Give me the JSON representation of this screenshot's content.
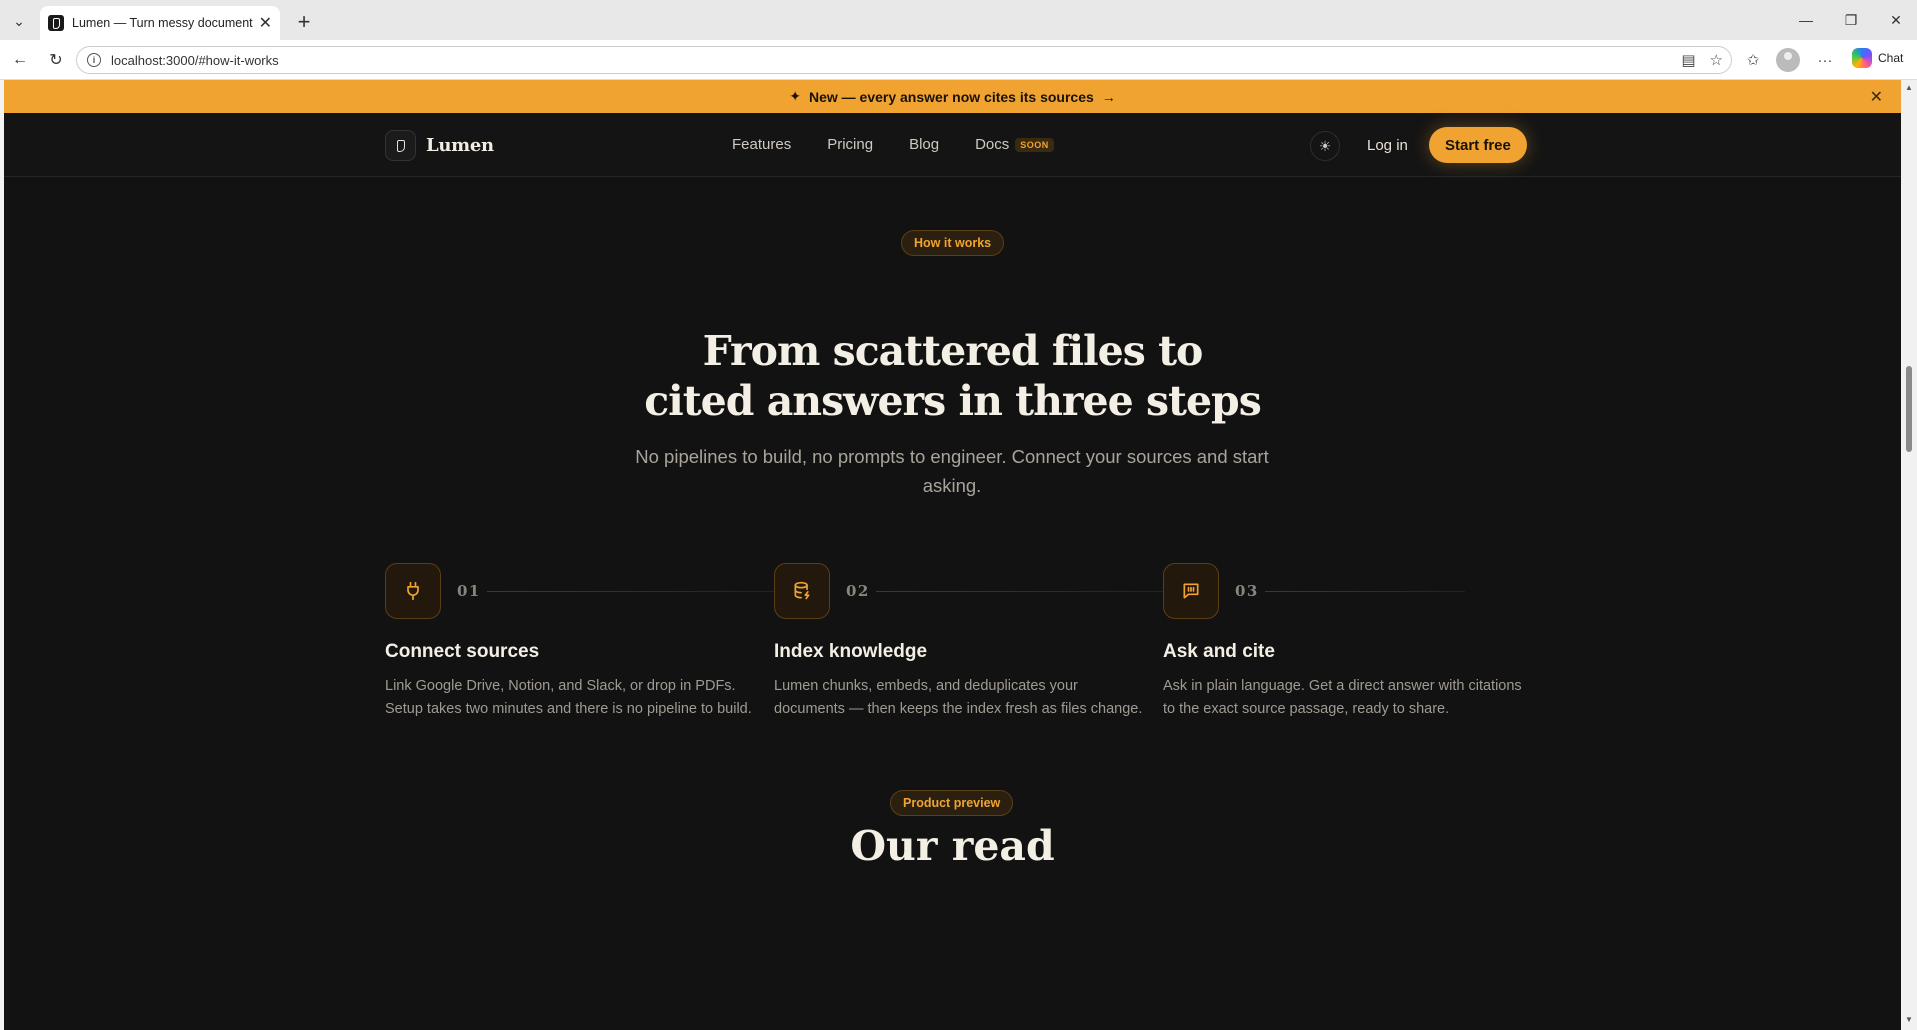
{
  "browser": {
    "tab_title": "Lumen — Turn messy documents",
    "url": "localhost:3000/#how-it-works",
    "chat_label": "Chat"
  },
  "announcement": {
    "text": "New — every answer now cites its sources",
    "arrow": "→"
  },
  "nav": {
    "brand": "Lumen",
    "links": [
      "Features",
      "Pricing",
      "Blog",
      "Docs"
    ],
    "docs_badge": "SOON",
    "login": "Log in",
    "cta": "Start free"
  },
  "how_it_works": {
    "pill": "How it works",
    "headline_line1": "From scattered files to",
    "headline_line2": "cited answers in three steps",
    "subhead": "No pipelines to build, no prompts to engineer. Connect your sources and start asking.",
    "steps": [
      {
        "num": "01",
        "icon": "plug-icon",
        "title": "Connect sources",
        "desc": "Link Google Drive, Notion, and Slack, or drop in PDFs. Setup takes two minutes and there is no pipeline to build."
      },
      {
        "num": "02",
        "icon": "database-icon",
        "title": "Index knowledge",
        "desc": "Lumen chunks, embeds, and deduplicates your documents — then keeps the index fresh as files change."
      },
      {
        "num": "03",
        "icon": "chat-icon",
        "title": "Ask and cite",
        "desc": "Ask in plain language. Get a direct answer with citations to the exact source passage, ready to share."
      }
    ]
  },
  "product_preview": {
    "pill": "Product preview",
    "title_partial": "Our read"
  },
  "colors": {
    "accent": "#f0a330",
    "background": "#121212",
    "text": "#f4efe4"
  }
}
